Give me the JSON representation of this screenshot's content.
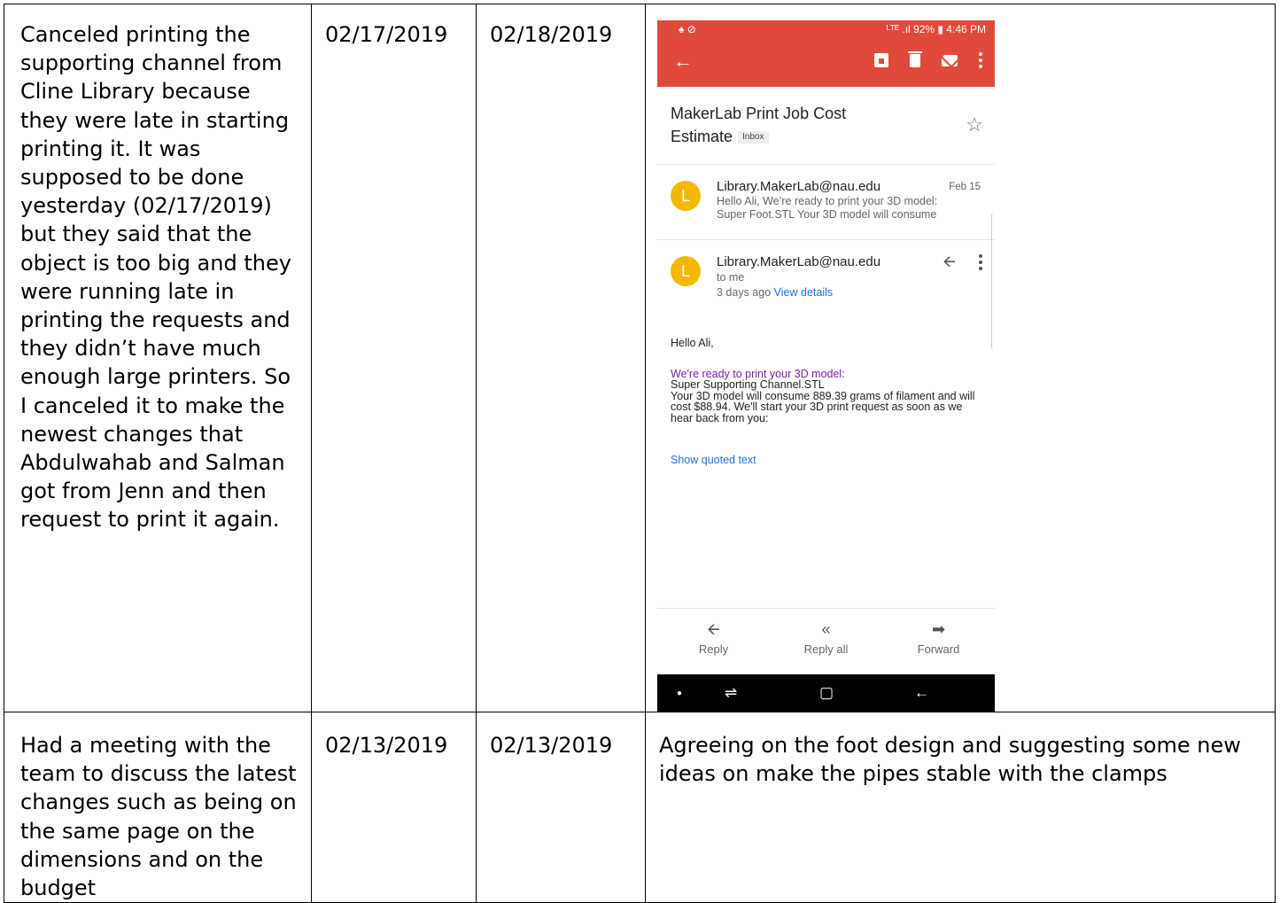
{
  "rows": [
    {
      "description": "Canceled printing the supporting channel from Cline Library because they were late in starting printing it. It was supposed to be done yesterday (02/17/2019) but they said that the object is too big and they were running late in printing the requests and they didn’t have much enough large printers. So I canceled it to make the newest changes that Abdulwahab and Salman got from Jenn and then request to print it again.",
      "start_date": "02/17/2019",
      "end_date": "02/18/2019"
    },
    {
      "description": "Had a meeting with the team to discuss the latest changes such as being on the same page on the dimensions and on the budget",
      "start_date": "02/13/2019",
      "end_date": "02/13/2019",
      "result": "Agreeing on the foot design and suggesting some new ideas on make the pipes stable with the clamps"
    }
  ],
  "phone": {
    "status_left": "♠ ⊘",
    "status_right": "ᴸᵀᴱ .ıl 92% ▮ 4:46 PM",
    "accent_color": "#e04a3c",
    "subject_line1": "MakerLab Print Job Cost",
    "subject_line2": "Estimate",
    "badge": "Inbox",
    "msg1": {
      "avatar": "L",
      "sender": "Library.MakerLab@nau.edu",
      "date": "Feb 15",
      "preview1": "Hello Ali, We’re ready to print your 3D model:",
      "preview2": "Super Foot.STL Your 3D model will consume"
    },
    "msg2": {
      "avatar": "L",
      "sender": "Library.MakerLab@nau.edu",
      "to": "to me",
      "when": "3 days ago",
      "details": "View details"
    },
    "body": {
      "greeting": "Hello Ali,",
      "ready": "We're ready to print your 3D model:",
      "file": "Super Supporting Channel.STL",
      "line3": "Your 3D model will consume 889.39 grams of filament and will",
      "line4": "cost $88.94. We'll start your 3D print request as soon as we",
      "line5": "hear back from you:"
    },
    "show_quoted": "Show quoted text",
    "reply": "Reply",
    "reply_all": "Reply all",
    "forward": "Forward"
  }
}
